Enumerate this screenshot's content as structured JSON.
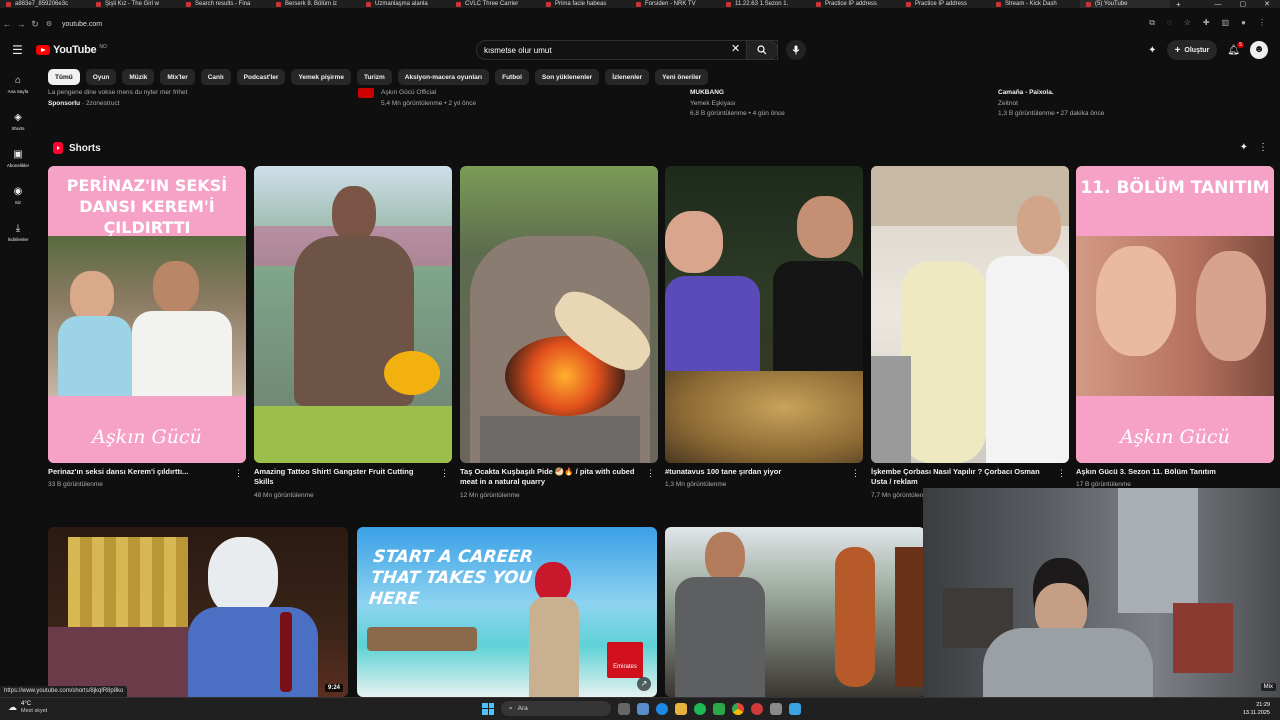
{
  "browser": {
    "tabs": [
      "a883e7_859206e3c",
      "Şişli Kız - The Girl w",
      "Search results - Fina",
      "Berserk 8. Bölüm iz",
      "Uzmanlaşma alanla",
      "CVLC Three Carrier",
      "Prima facie habeas",
      "Forsiden - NRK TV",
      "11.22.63 1.Sezon 1.",
      "Practice IP address",
      "Practice IP address",
      "Stream - Kick Dash",
      "(5) YouTube"
    ],
    "new_tab": "+",
    "url": "youtube.com",
    "window_controls": [
      "—",
      "▢",
      "✕"
    ]
  },
  "header": {
    "logo_text": "YouTube",
    "logo_region": "NO",
    "search_query": "kısmetse olur umut",
    "create_label": "Oluştur",
    "notifications_badge": "5"
  },
  "sidebar": {
    "items": [
      {
        "icon": "home-icon",
        "label": "Ana Sayfa"
      },
      {
        "icon": "shorts-icon",
        "label": "Shorts"
      },
      {
        "icon": "subscriptions-icon",
        "label": "Abonelikler"
      },
      {
        "icon": "you-icon",
        "label": "Siz"
      },
      {
        "icon": "downloads-icon",
        "label": "İndirilenler"
      }
    ]
  },
  "chips": [
    "Tümü",
    "Oyun",
    "Müzik",
    "Mix'ler",
    "Canlı",
    "Podcast'ler",
    "Yemek pişirme",
    "Turizm",
    "Aksiyon-macera oyunları",
    "Futbol",
    "Son yüklenenler",
    "İzlenenler",
    "Yeni öneriler"
  ],
  "prev_row": [
    {
      "line1": "La pengene dine vokse mens du nyter mer frihet",
      "sponsor": "Sponsorlu",
      "channel": "2zonestruct"
    },
    {
      "channel": "Aşkın Gücü Official",
      "meta": "5,4 Mn görüntülenme • 2 yıl önce"
    },
    {
      "title": "MUKBANG",
      "channel": "Yemek Eşkiyası",
      "meta": "6,8 B görüntülenme • 4 gün önce"
    },
    {
      "title": "Camaña - Paixola.",
      "channel": "Zeitnot",
      "meta": "1,3 B görüntülenme • 27 dakika önce"
    }
  ],
  "shorts": {
    "heading": "Shorts",
    "items": [
      {
        "title": "Perinaz'ın seksi dansı Kerem'i çıldırttı...",
        "views": "33 B görüntülenme",
        "overlay": "PERİNAZ'IN SEKSİ DANSI KEREM'İ ÇILDIRTTI",
        "script": "Aşkın Gücü"
      },
      {
        "title": "Amazing Tattoo Shirt! Gangster Fruit Cutting Skills",
        "views": "48 Mn görüntülenme"
      },
      {
        "title": "Taş Ocakta Kuşbaşılı Pide 🥙🔥 / pita with cubed meat in a natural quarry",
        "views": "12 Mn görüntülenme"
      },
      {
        "title": "#tunatavus 100 tane şırdan yiyor",
        "views": "1,3 Mn görüntülenme"
      },
      {
        "title": "İşkembe Çorbası Nasıl Yapılır ? Çorbacı Osman Usta / reklam",
        "views": "7,7 Mn görüntülenme"
      },
      {
        "title": "Aşkın Gücü 3. Sezon 11. Bölüm Tanıtım",
        "views": "17 B görüntülenme",
        "overlay": "11. BÖLÜM TANITIM",
        "script": "Aşkın Gücü"
      }
    ]
  },
  "videos": [
    {
      "duration": "9:24"
    },
    {
      "ad_text": "START A CAREER THAT TAKES YOU HERE",
      "brand": "Emirates"
    },
    {
      "duration": ""
    }
  ],
  "webcam": {
    "tag": "Mix"
  },
  "status_url": "https://www.youtube.com/shorts/8jkqlR8p8ko",
  "taskbar": {
    "temp": "4°C",
    "weather": "Mest skyet",
    "search": "Ara",
    "time": "21:29",
    "date": "13.11.2025"
  }
}
